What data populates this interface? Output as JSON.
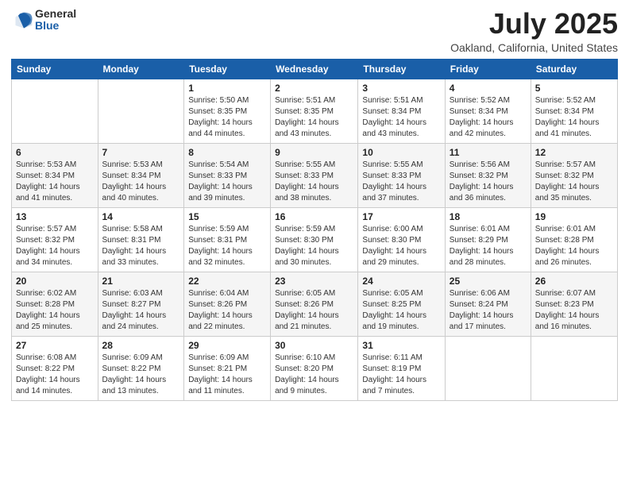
{
  "header": {
    "logo_general": "General",
    "logo_blue": "Blue",
    "title": "July 2025",
    "location": "Oakland, California, United States"
  },
  "weekdays": [
    "Sunday",
    "Monday",
    "Tuesday",
    "Wednesday",
    "Thursday",
    "Friday",
    "Saturday"
  ],
  "weeks": [
    [
      {
        "day": "",
        "info": ""
      },
      {
        "day": "",
        "info": ""
      },
      {
        "day": "1",
        "info": "Sunrise: 5:50 AM\nSunset: 8:35 PM\nDaylight: 14 hours and 44 minutes."
      },
      {
        "day": "2",
        "info": "Sunrise: 5:51 AM\nSunset: 8:35 PM\nDaylight: 14 hours and 43 minutes."
      },
      {
        "day": "3",
        "info": "Sunrise: 5:51 AM\nSunset: 8:34 PM\nDaylight: 14 hours and 43 minutes."
      },
      {
        "day": "4",
        "info": "Sunrise: 5:52 AM\nSunset: 8:34 PM\nDaylight: 14 hours and 42 minutes."
      },
      {
        "day": "5",
        "info": "Sunrise: 5:52 AM\nSunset: 8:34 PM\nDaylight: 14 hours and 41 minutes."
      }
    ],
    [
      {
        "day": "6",
        "info": "Sunrise: 5:53 AM\nSunset: 8:34 PM\nDaylight: 14 hours and 41 minutes."
      },
      {
        "day": "7",
        "info": "Sunrise: 5:53 AM\nSunset: 8:34 PM\nDaylight: 14 hours and 40 minutes."
      },
      {
        "day": "8",
        "info": "Sunrise: 5:54 AM\nSunset: 8:33 PM\nDaylight: 14 hours and 39 minutes."
      },
      {
        "day": "9",
        "info": "Sunrise: 5:55 AM\nSunset: 8:33 PM\nDaylight: 14 hours and 38 minutes."
      },
      {
        "day": "10",
        "info": "Sunrise: 5:55 AM\nSunset: 8:33 PM\nDaylight: 14 hours and 37 minutes."
      },
      {
        "day": "11",
        "info": "Sunrise: 5:56 AM\nSunset: 8:32 PM\nDaylight: 14 hours and 36 minutes."
      },
      {
        "day": "12",
        "info": "Sunrise: 5:57 AM\nSunset: 8:32 PM\nDaylight: 14 hours and 35 minutes."
      }
    ],
    [
      {
        "day": "13",
        "info": "Sunrise: 5:57 AM\nSunset: 8:32 PM\nDaylight: 14 hours and 34 minutes."
      },
      {
        "day": "14",
        "info": "Sunrise: 5:58 AM\nSunset: 8:31 PM\nDaylight: 14 hours and 33 minutes."
      },
      {
        "day": "15",
        "info": "Sunrise: 5:59 AM\nSunset: 8:31 PM\nDaylight: 14 hours and 32 minutes."
      },
      {
        "day": "16",
        "info": "Sunrise: 5:59 AM\nSunset: 8:30 PM\nDaylight: 14 hours and 30 minutes."
      },
      {
        "day": "17",
        "info": "Sunrise: 6:00 AM\nSunset: 8:30 PM\nDaylight: 14 hours and 29 minutes."
      },
      {
        "day": "18",
        "info": "Sunrise: 6:01 AM\nSunset: 8:29 PM\nDaylight: 14 hours and 28 minutes."
      },
      {
        "day": "19",
        "info": "Sunrise: 6:01 AM\nSunset: 8:28 PM\nDaylight: 14 hours and 26 minutes."
      }
    ],
    [
      {
        "day": "20",
        "info": "Sunrise: 6:02 AM\nSunset: 8:28 PM\nDaylight: 14 hours and 25 minutes."
      },
      {
        "day": "21",
        "info": "Sunrise: 6:03 AM\nSunset: 8:27 PM\nDaylight: 14 hours and 24 minutes."
      },
      {
        "day": "22",
        "info": "Sunrise: 6:04 AM\nSunset: 8:26 PM\nDaylight: 14 hours and 22 minutes."
      },
      {
        "day": "23",
        "info": "Sunrise: 6:05 AM\nSunset: 8:26 PM\nDaylight: 14 hours and 21 minutes."
      },
      {
        "day": "24",
        "info": "Sunrise: 6:05 AM\nSunset: 8:25 PM\nDaylight: 14 hours and 19 minutes."
      },
      {
        "day": "25",
        "info": "Sunrise: 6:06 AM\nSunset: 8:24 PM\nDaylight: 14 hours and 17 minutes."
      },
      {
        "day": "26",
        "info": "Sunrise: 6:07 AM\nSunset: 8:23 PM\nDaylight: 14 hours and 16 minutes."
      }
    ],
    [
      {
        "day": "27",
        "info": "Sunrise: 6:08 AM\nSunset: 8:22 PM\nDaylight: 14 hours and 14 minutes."
      },
      {
        "day": "28",
        "info": "Sunrise: 6:09 AM\nSunset: 8:22 PM\nDaylight: 14 hours and 13 minutes."
      },
      {
        "day": "29",
        "info": "Sunrise: 6:09 AM\nSunset: 8:21 PM\nDaylight: 14 hours and 11 minutes."
      },
      {
        "day": "30",
        "info": "Sunrise: 6:10 AM\nSunset: 8:20 PM\nDaylight: 14 hours and 9 minutes."
      },
      {
        "day": "31",
        "info": "Sunrise: 6:11 AM\nSunset: 8:19 PM\nDaylight: 14 hours and 7 minutes."
      },
      {
        "day": "",
        "info": ""
      },
      {
        "day": "",
        "info": ""
      }
    ]
  ]
}
